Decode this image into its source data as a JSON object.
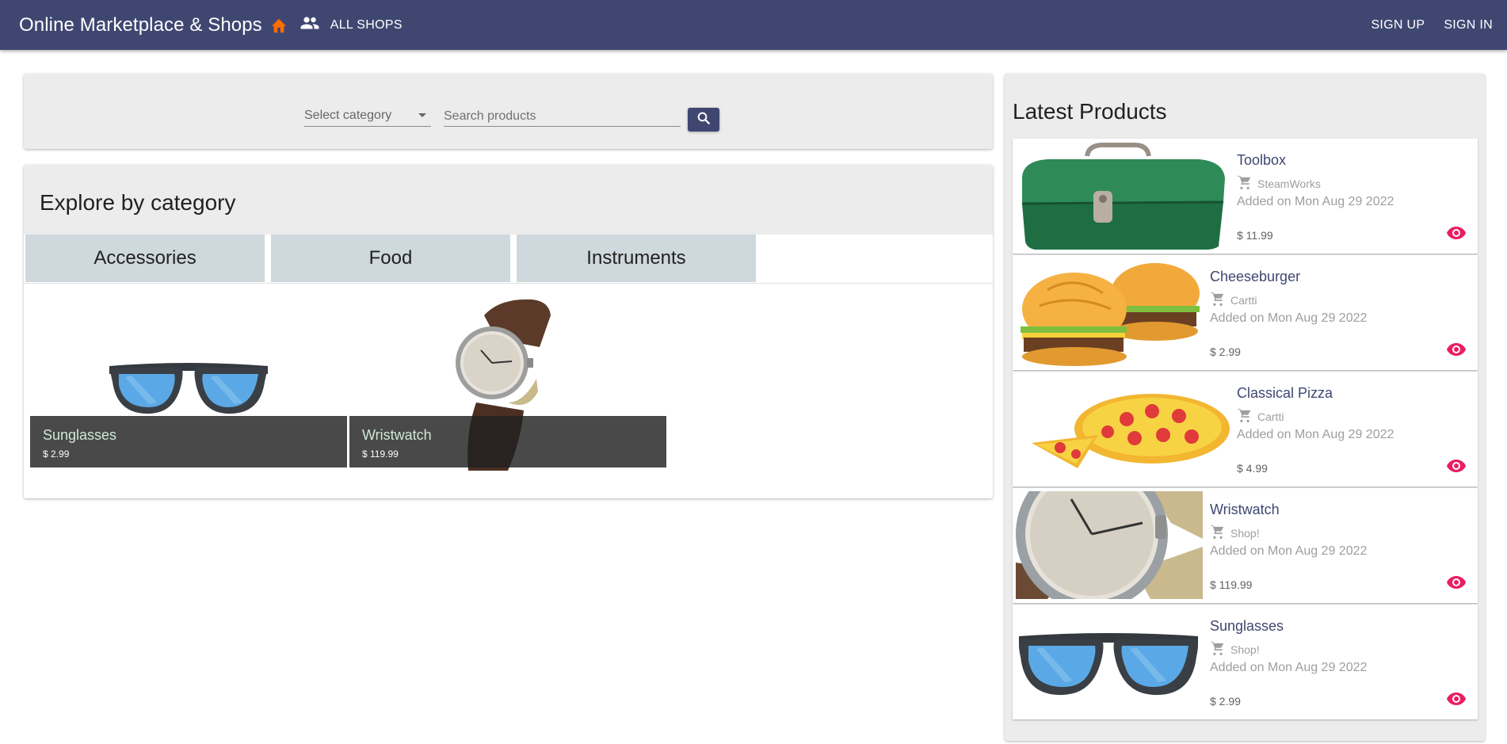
{
  "appbar": {
    "title": "Online Marketplace & Shops",
    "home_icon": "home-icon",
    "shops_icon": "people-icon",
    "all_shops_label": "ALL SHOPS",
    "signup_label": "SIGN UP",
    "signin_label": "SIGN IN"
  },
  "search": {
    "category_value": "Select category",
    "placeholder": "Search products",
    "button_icon": "search-icon"
  },
  "categories": {
    "title": "Explore by category",
    "tabs": [
      {
        "label": "Accessories",
        "selected": true
      },
      {
        "label": "Food",
        "selected": false
      },
      {
        "label": "Instruments",
        "selected": false
      }
    ],
    "products": [
      {
        "name": "Sunglasses",
        "price": "$ 2.99",
        "image": "sunglasses"
      },
      {
        "name": "Wristwatch",
        "price": "$ 119.99",
        "image": "wristwatch"
      }
    ]
  },
  "latest": {
    "title": "Latest Products",
    "items": [
      {
        "name": "Toolbox",
        "shop": "SteamWorks",
        "added": "Added on Mon Aug 29 2022",
        "price": "$ 11.99",
        "image": "toolbox"
      },
      {
        "name": "Cheeseburger",
        "shop": "Cartti",
        "added": "Added on Mon Aug 29 2022",
        "price": "$ 2.99",
        "image": "cheeseburger"
      },
      {
        "name": "Classical Pizza",
        "shop": "Cartti",
        "added": "Added on Mon Aug 29 2022",
        "price": "$ 4.99",
        "image": "pizza"
      },
      {
        "name": "Wristwatch",
        "shop": "Shop!",
        "added": "Added on Mon Aug 29 2022",
        "price": "$ 119.99",
        "image": "wristwatch"
      },
      {
        "name": "Sunglasses",
        "shop": "Shop!",
        "added": "Added on Mon Aug 29 2022",
        "price": "$ 2.99",
        "image": "sunglasses"
      }
    ]
  },
  "colors": {
    "appbar": "#3f4771",
    "home_icon": "#ff6d00",
    "view_icon": "#e91e63",
    "tab_bg": "#cfd8dc",
    "card_bg": "#ececec"
  }
}
